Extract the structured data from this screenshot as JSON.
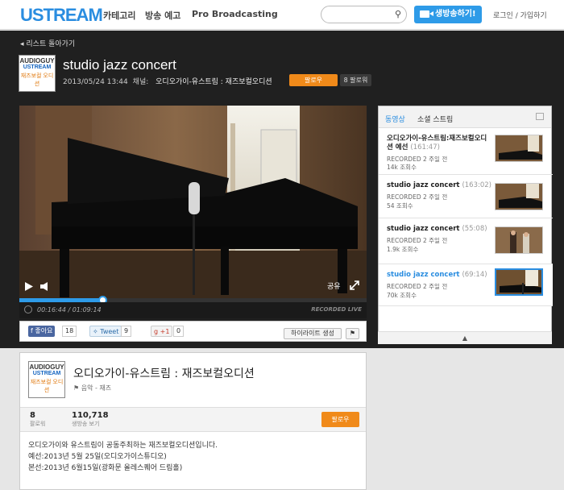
{
  "header": {
    "logo": "USTREAM",
    "nav": [
      "카테고리",
      "방송 예고",
      "Pro Broadcasting"
    ],
    "search_placeholder": "",
    "go_live": "생방송하기!",
    "login": "로그인 / 가입하기"
  },
  "page": {
    "back": "리스트 돌아가기",
    "title": "studio jazz concert",
    "datetime": "2013/05/24 13:44",
    "channel_label": "채널:",
    "channel_name": "오디오가이-유스트림 : 재즈보컬오디션",
    "follow": "팔로우",
    "followers": "8 팔로워"
  },
  "channel_logo": {
    "line1": "AUDIOGUY",
    "line2": "USTREAM",
    "line3": "재즈보컬 오디션"
  },
  "player": {
    "share": "공유",
    "time": "00:16:44 / 01:09:14",
    "recorded": "RECORDED LIVE",
    "progress_fraction": 0.24
  },
  "social": {
    "like": "좋아요",
    "like_count": "18",
    "tweet": "Tweet",
    "tweet_count": "9",
    "gplus": "+1",
    "gplus_count": "0",
    "highlight": "하이라이트 생성",
    "flag": "⚑"
  },
  "sidebar": {
    "tabs": [
      "동영상",
      "소셜 스트림"
    ],
    "items": [
      {
        "title": "오디오가이-유스트림:재즈보컬오디션 예선",
        "duration": "(161:47)",
        "recorded": "RECORDED 2 주일 전",
        "views": "14k 조회수"
      },
      {
        "title": "studio jazz concert",
        "duration": "(163:02)",
        "recorded": "RECORDED 2 주일 전",
        "views": "54 조회수"
      },
      {
        "title": "studio jazz concert",
        "duration": "(55:08)",
        "recorded": "RECORDED 2 주일 전",
        "views": "1.9k 조회수"
      },
      {
        "title": "studio jazz concert",
        "duration": "(69:14)",
        "recorded": "RECORDED 2 주일 전",
        "views": "70k 조회수"
      }
    ]
  },
  "channel": {
    "name": "오디오가이-유스트림 : 재즈보컬오디션",
    "category": "음악 - 재즈",
    "followers": "8",
    "followers_label": "팔로워",
    "views": "110,718",
    "views_label": "생방송 보기",
    "follow": "팔로우",
    "desc1": "오디오가이와 유스트림이 공동주최하는 재즈보컬오디션입니다.",
    "desc2": "예선:2013년 5월 25일(오디오가이스튜디오)",
    "desc3": "본선:2013년 6월15일(광화문 올레스퀘어 드림홀)"
  },
  "colors": {
    "accent": "#2a8de0",
    "orange": "#f08a1a",
    "dark": "#202020"
  }
}
